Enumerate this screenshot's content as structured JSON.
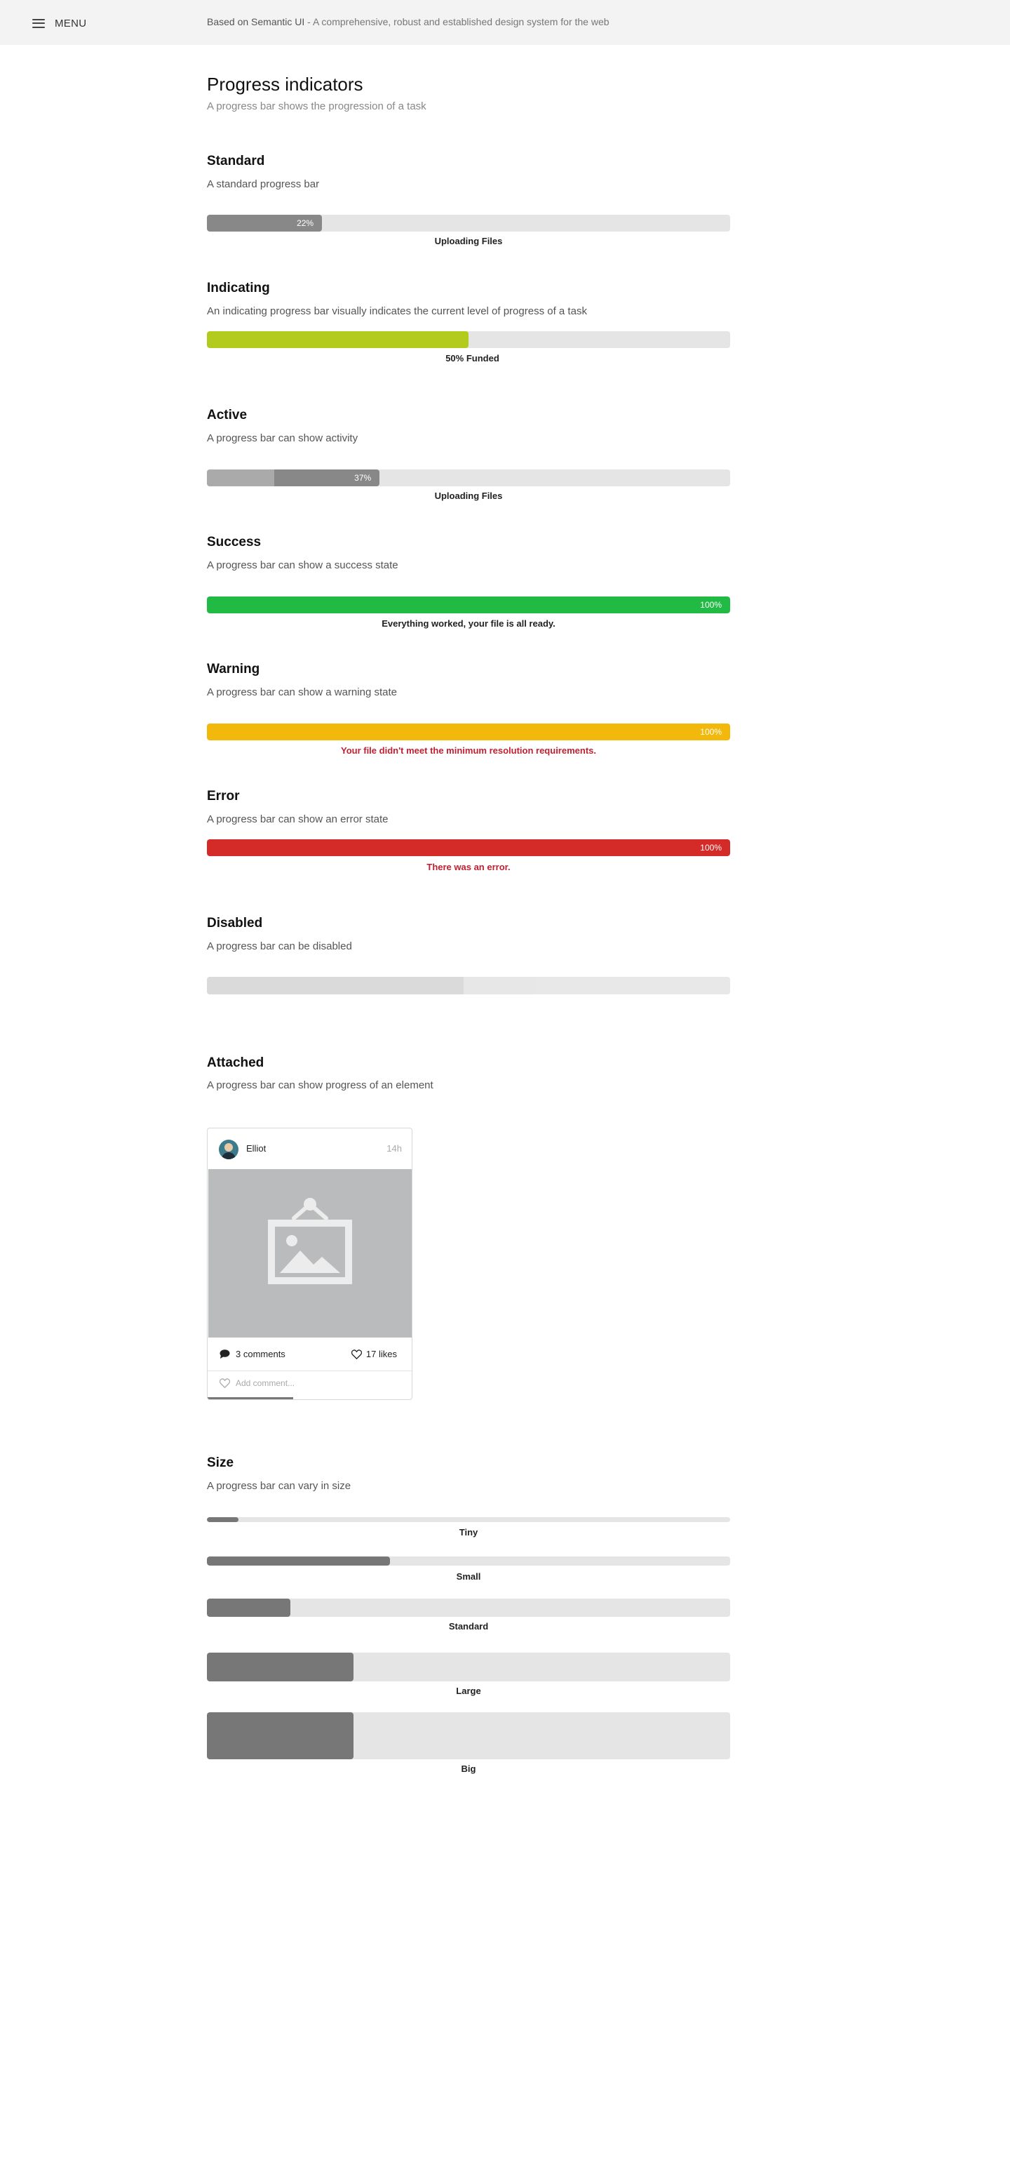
{
  "header": {
    "menu_label": "MENU",
    "brand": "Based on Semantic UI",
    "tagline": " - A comprehensive, robust and established design system for the web"
  },
  "page": {
    "title": "Progress indicators",
    "subtitle": "A progress bar shows the progression of a task"
  },
  "colors": {
    "neutral_fill": "#888888",
    "neutral_dark": "#777777",
    "track": "#e5e5e5",
    "indicating": "#b2cb1c",
    "success": "#21ba45",
    "warning": "#f2b80c",
    "error": "#d42a28",
    "error_text": "#c0202f",
    "disabled_fill": "#d6d6d6"
  },
  "sections": {
    "standard": {
      "title": "Standard",
      "desc": "A standard progress bar",
      "percent_text": "22%",
      "percent": 22,
      "label": "Uploading Files"
    },
    "indicating": {
      "title": "Indicating",
      "desc": "An indicating progress bar visually indicates the current level of progress of a task",
      "percent": 50,
      "label": "50% Funded"
    },
    "active": {
      "title": "Active",
      "desc": "A progress bar can show activity",
      "percent_text": "37%",
      "percent": 33,
      "label": "Uploading Files"
    },
    "success": {
      "title": "Success",
      "desc": "A progress bar can show a success state",
      "percent_text": "100%",
      "percent": 100,
      "label": "Everything worked, your file is all ready."
    },
    "warning": {
      "title": "Warning",
      "desc": "A progress bar can show a warning state",
      "percent_text": "100%",
      "percent": 100,
      "label": "Your file didn't meet the minimum resolution requirements."
    },
    "error": {
      "title": "Error",
      "desc": "A progress bar can show an error state",
      "percent_text": "100%",
      "percent": 100,
      "label": "There was an error."
    },
    "disabled": {
      "title": "Disabled",
      "desc": "A progress bar can be disabled",
      "percent": 49
    },
    "attached": {
      "title": "Attached",
      "desc": "A progress bar can show progress of an element",
      "card": {
        "username": "Elliot",
        "time": "14h",
        "comments": "3 comments",
        "likes": "17 likes",
        "add_comment_placeholder": "Add comment...",
        "attached_percent": 42
      }
    },
    "size": {
      "title": "Size",
      "desc": "A progress bar can vary in size",
      "bars": [
        {
          "label": "Tiny",
          "percent": 6
        },
        {
          "label": "Small",
          "percent": 35
        },
        {
          "label": "Standard",
          "percent": 16
        },
        {
          "label": "Large",
          "percent": 28
        },
        {
          "label": "Big",
          "percent": 28
        }
      ]
    }
  }
}
